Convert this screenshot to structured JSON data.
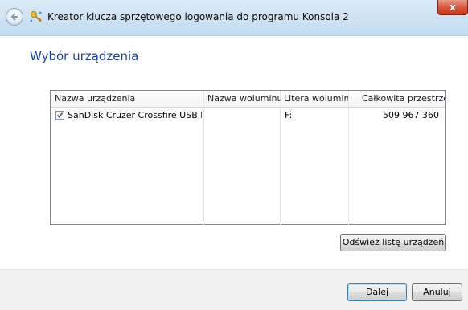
{
  "window": {
    "title": "Kreator klucza sprzętowego logowania do programu Konsola 2",
    "close_label": "x"
  },
  "page": {
    "heading": "Wybór urządzenia"
  },
  "device_list": {
    "columns": [
      "Nazwa urządzenia",
      "Nazwa woluminu",
      "Litera woluminu",
      "Całkowita przestrzeń"
    ],
    "rows": [
      {
        "checked": true,
        "device_name": "SanDisk Cruzer Crossfire USB D...",
        "volume_name": "",
        "volume_letter": "F:",
        "total_space": "509 967 360"
      }
    ]
  },
  "buttons": {
    "refresh": "Odśwież listę urządzeń",
    "next_mnemonic": "D",
    "next_rest": "alej",
    "cancel": "Anuluj"
  },
  "colors": {
    "heading": "#1a3e9c",
    "close_button": "#c5381c"
  }
}
